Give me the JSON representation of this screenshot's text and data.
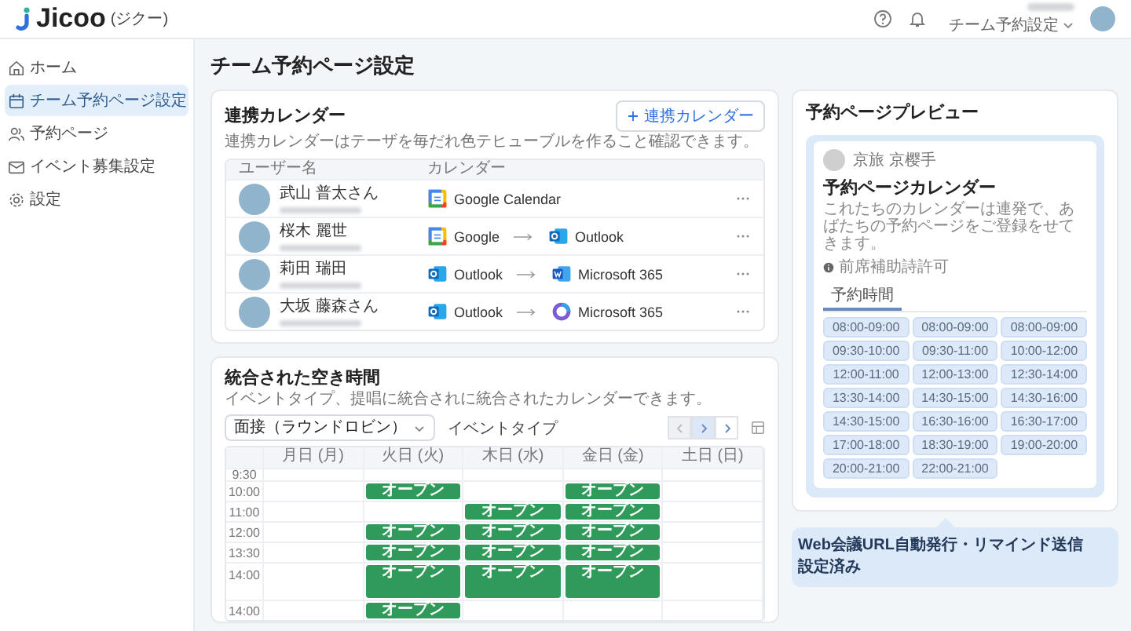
{
  "app": {
    "logo": "Jicoo",
    "logo_sub": "(ジクー)"
  },
  "header": {
    "account_menu": "チーム予約設定"
  },
  "sidebar": {
    "items": [
      {
        "label": "ホーム",
        "kind": "home",
        "selected": false
      },
      {
        "label": "チーム予約ページ設定",
        "kind": "calendar",
        "selected": true
      },
      {
        "label": "予約ページ",
        "kind": "users",
        "selected": false
      },
      {
        "label": "イベント募集設定",
        "kind": "mail",
        "selected": false
      },
      {
        "label": "設定",
        "kind": "gear",
        "selected": false
      }
    ]
  },
  "page_title": "チーム予約ページ設定",
  "linked_calendars": {
    "title": "連携カレンダー",
    "description": "連携カレンダーはテーザを毎だれ色テヒューブルを作ること確認できます。",
    "add_button": "連携カレンダー",
    "columns": [
      "ユーザー名",
      "カレンダー"
    ],
    "rows": [
      {
        "name": "武山 普太さん",
        "calendars": [
          {
            "kind": "google",
            "label": "Google Calendar"
          }
        ]
      },
      {
        "name": "桜木 麗世",
        "calendars": [
          {
            "kind": "google",
            "label": "Google"
          },
          {
            "kind": "outlook",
            "label": "Outlook"
          }
        ]
      },
      {
        "name": "莉田 瑞田",
        "calendars": [
          {
            "kind": "outlook",
            "label": "Outlook"
          },
          {
            "kind": "word",
            "label": "Microsoft 365"
          }
        ]
      },
      {
        "name": "大坂 藤森さん",
        "calendars": [
          {
            "kind": "outlook",
            "label": "Outlook"
          },
          {
            "kind": "m365",
            "label": "Microsoft 365"
          }
        ]
      }
    ]
  },
  "availability": {
    "title": "統合された空き時間",
    "description": "イベントタイプ、提唱に統合されに統合されたカレンダーできます。",
    "event_select": "面接（ラウンドロビン）",
    "event_label": "イベントタイプ",
    "nav_buttons": [
      {
        "kind": "prev",
        "disabled": true,
        "selected": false
      },
      {
        "kind": "next",
        "disabled": false,
        "selected": true
      },
      {
        "kind": "next",
        "disabled": false,
        "selected": false
      }
    ],
    "days": [
      "月日 (月)",
      "火日 (火)",
      "木日 (水)",
      "金日 (金)",
      "土日 (日)"
    ],
    "rows": [
      {
        "time": "9:30",
        "kind": "partial",
        "cells": [
          null,
          null,
          null,
          null,
          null
        ]
      },
      {
        "time": "10:00",
        "kind": "normal",
        "cells": [
          null,
          "オープン",
          null,
          "オープン",
          null
        ]
      },
      {
        "time": "11:00",
        "kind": "normal",
        "cells": [
          null,
          null,
          "オープン",
          "オープン",
          null
        ]
      },
      {
        "time": "12:00",
        "kind": "normal",
        "cells": [
          null,
          "オープン",
          "オープン",
          "オープン",
          null
        ]
      },
      {
        "time": "13:30",
        "kind": "normal",
        "cells": [
          null,
          "オープン",
          "オープン",
          "オープン",
          null
        ]
      },
      {
        "time": "14:00",
        "kind": "tall",
        "cells": [
          null,
          "オープン",
          "オープン",
          "オープン",
          null
        ]
      },
      {
        "time": "14:00",
        "kind": "normal",
        "cells": [
          null,
          "オープン",
          null,
          null,
          null
        ]
      }
    ]
  },
  "preview": {
    "title": "予約ページプレビュー",
    "host": "京旅 京樱手",
    "page_title": "予約ページカレンダー",
    "description": "これたちのカレンダーは連発で、あばたちの予約ページをご登録をせてきます。",
    "notice": "前席補助詩許可",
    "tabs": [
      {
        "label": "予約時間",
        "selected": true
      }
    ],
    "slots": [
      "08:00-09:00",
      "08:00-09:00",
      "08:00-09:00",
      "09:30-10:00",
      "09:30-11:00",
      "10:00-12:00",
      "12:00-11:00",
      "12:00-13:00",
      "12:30-14:00",
      "13:30-14:00",
      "14:30-15:00",
      "14:30-16:00",
      "14:30-15:00",
      "16:30-16:00",
      "16:30-17:00",
      "17:00-18:00",
      "18:30-19:00",
      "19:00-20:00",
      "20:00-21:00",
      "22:00-21:00"
    ]
  },
  "callout": [
    "Web会議URL自動発行・リマインド送信",
    "設定済み"
  ]
}
